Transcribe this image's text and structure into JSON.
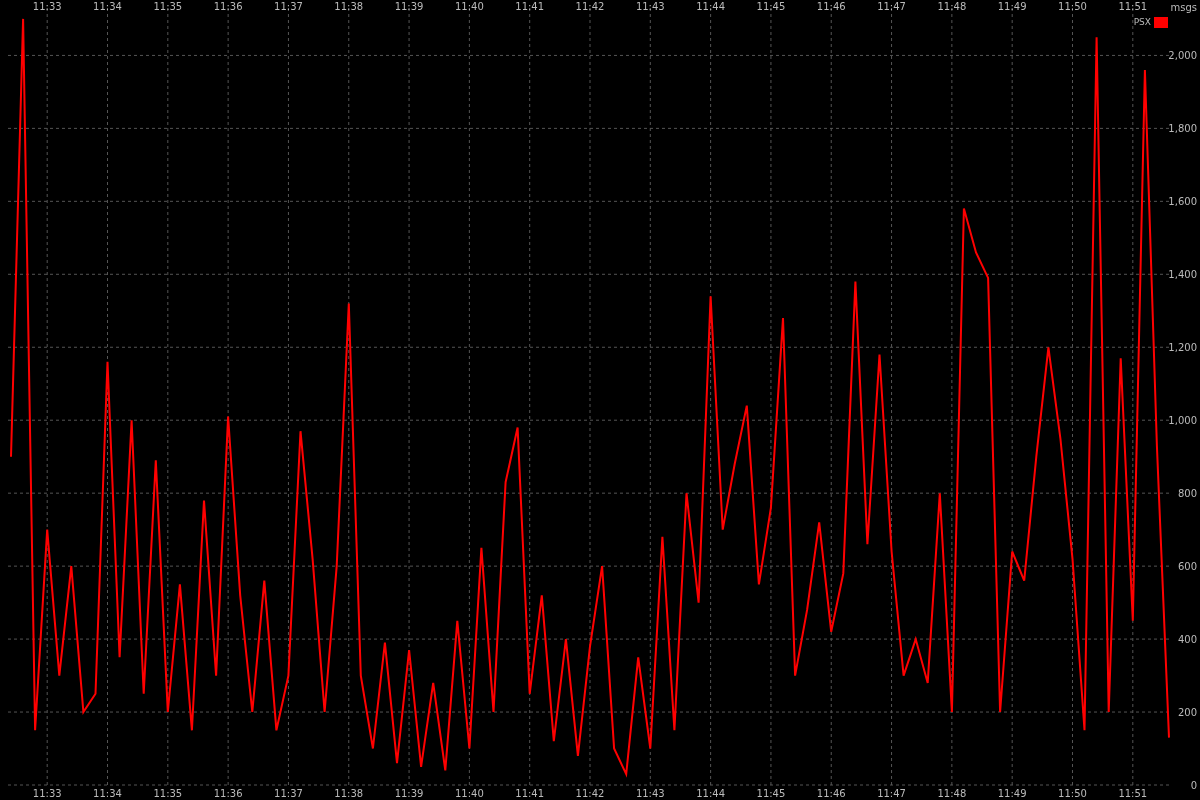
{
  "chart": {
    "top_xtick_labels": [
      "11:33",
      "11:34",
      "11:35",
      "11:36",
      "11:37",
      "11:38",
      "11:39",
      "11:40",
      "11:41",
      "11:42",
      "11:43",
      "11:44",
      "11:45",
      "11:46",
      "11:47",
      "11:48",
      "11:49",
      "11:50",
      "11:51"
    ],
    "chart_data": {
      "type": "line",
      "ylabel": "msgs",
      "categories": [
        null,
        null,
        null,
        "11:33",
        null,
        null,
        null,
        null,
        "11:34",
        null,
        null,
        null,
        null,
        "11:35",
        null,
        null,
        null,
        null,
        "11:36",
        null,
        null,
        null,
        null,
        "11:37",
        null,
        null,
        null,
        null,
        "11:38",
        null,
        null,
        null,
        null,
        "11:39",
        null,
        null,
        null,
        null,
        "11:40",
        null,
        null,
        null,
        null,
        "11:41",
        null,
        null,
        null,
        null,
        "11:42",
        null,
        null,
        null,
        null,
        "11:43",
        null,
        null,
        null,
        null,
        "11:44",
        null,
        null,
        null,
        null,
        "11:45",
        null,
        null,
        null,
        null,
        "11:46",
        null,
        null,
        null,
        null,
        "11:47",
        null,
        null,
        null,
        null,
        "11:48",
        null,
        null,
        null,
        null,
        "11:49",
        null,
        null,
        null,
        null,
        "11:50",
        null,
        null,
        null,
        null,
        "11:51",
        null,
        null,
        null
      ],
      "series": [
        {
          "name": "PSX",
          "color": "#ff0000",
          "values": [
            900,
            2100,
            150,
            700,
            300,
            600,
            200,
            250,
            1160,
            350,
            1000,
            250,
            890,
            200,
            550,
            150,
            780,
            300,
            1010,
            520,
            200,
            560,
            150,
            300,
            970,
            620,
            200,
            600,
            1320,
            300,
            100,
            390,
            60,
            370,
            50,
            280,
            40,
            450,
            100,
            650,
            200,
            830,
            980,
            250,
            520,
            120,
            400,
            80,
            380,
            600,
            100,
            30,
            350,
            100,
            680,
            150,
            800,
            500,
            1340,
            700,
            880,
            1040,
            550,
            760,
            1280,
            300,
            480,
            720,
            420,
            580,
            1380,
            660,
            1180,
            640,
            300,
            400,
            280,
            800,
            200,
            1580,
            1460,
            1390,
            200,
            640,
            560,
            900,
            1200,
            950,
            620,
            150,
            2050,
            200,
            1170,
            450,
            1960,
            930,
            130
          ]
        }
      ],
      "grid": true,
      "ylim": [
        0,
        2130
      ],
      "yticks": [
        {
          "value": 0,
          "label": "0"
        },
        {
          "value": 200,
          "label": "200"
        },
        {
          "value": 400,
          "label": "400"
        },
        {
          "value": 600,
          "label": "600"
        },
        {
          "value": 800,
          "label": "800"
        },
        {
          "value": 1000,
          "label": "1,000"
        },
        {
          "value": 1200,
          "label": "1,200"
        },
        {
          "value": 1400,
          "label": "1,400"
        },
        {
          "value": 1600,
          "label": "1,600"
        },
        {
          "value": 1800,
          "label": "1,800"
        },
        {
          "value": 2000,
          "label": "2,000"
        }
      ]
    }
  }
}
